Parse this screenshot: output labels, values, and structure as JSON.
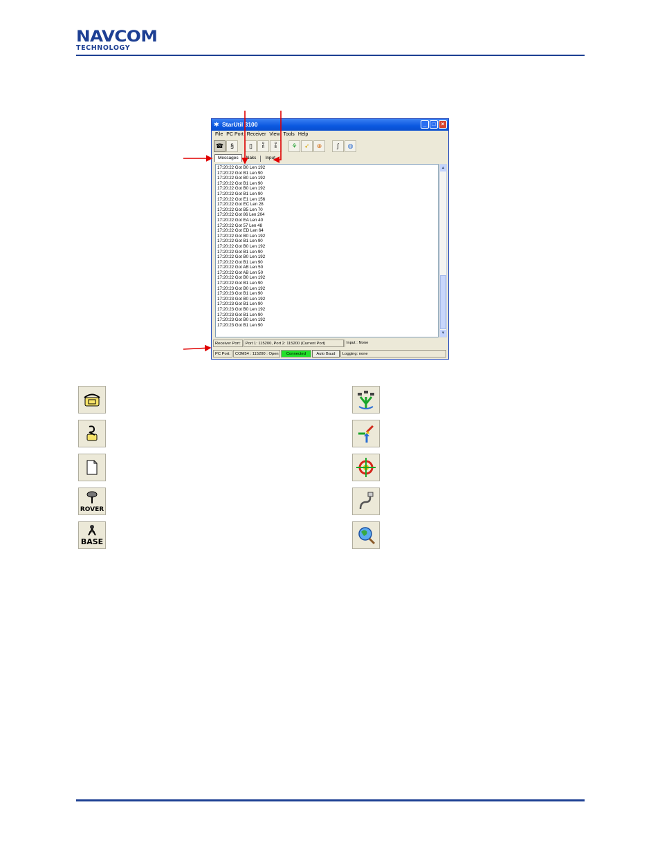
{
  "header": {
    "logo_main": "NAVCOM",
    "logo_sub": "TECHNOLOGY"
  },
  "window": {
    "title": "StarUtil 3100",
    "menu": [
      "File",
      "PC Port",
      "Receiver",
      "View",
      "Tools",
      "Help"
    ],
    "toolbar_icons": [
      "phone-connect-icon",
      "phone-disconnect-icon",
      "new-document-icon",
      "rover-icon",
      "base-icon",
      "network-icon",
      "merge-arrows-icon",
      "target-icon",
      "plug-icon",
      "globe-search-icon"
    ],
    "tabs": [
      "Messages",
      "Naks",
      "Input"
    ],
    "messages": [
      "17:20:22 Got B0 Len 192",
      "17:20:22 Got B1 Len 90",
      "17:20:22 Got B0 Len 192",
      "17:20:22 Got B1 Len 90",
      "17:20:22 Got B0 Len 192",
      "17:20:22 Got B1 Len 90",
      "17:20:22 Got E1 Len 156",
      "17:20:22 Got EC Len 28",
      "17:20:22 Got B5 Len 70",
      "17:20:22 Got 86 Len 204",
      "17:20:22 Got EA Len 40",
      "17:20:22 Got 57 Len 48",
      "17:20:22 Got ED Len 64",
      "17:20:22 Got B0 Len 192",
      "17:20:22 Got B1 Len 90",
      "17:20:22 Got B0 Len 192",
      "17:20:22 Got B1 Len 90",
      "17:20:22 Got B0 Len 192",
      "17:20:22 Got B1 Len 90",
      "17:20:22 Got AB Len 50",
      "17:20:22 Got AB Len 50",
      "17:20:22 Got B0 Len 192",
      "17:20:22 Got B1 Len 90",
      "17:20:23 Got B0 Len 192",
      "17:20:23 Got B1 Len 90",
      "17:20:23 Got B0 Len 192",
      "17:20:23 Got B1 Len 90",
      "17:20:23 Got B0 Len 192",
      "17:20:23 Got B1 Len 90",
      "17:20:23 Got B0 Len 192",
      "17:20:23 Got B1 Len 90"
    ],
    "status": {
      "receiver_port_label": "Receiver Port:",
      "receiver_port_value": "Port 1: 115200, Port 2: 115200 (Current Port)",
      "input": "Input : None",
      "pc_port_label": "PC Port:",
      "pc_port_value": "COM54 : 115200 : Open",
      "connection": "Connected",
      "auto_baud": "Auto Baud",
      "logging": "Logging: none"
    }
  },
  "legend_icons": {
    "left": [
      "phone-connect-icon",
      "phone-disconnect-icon",
      "new-document-icon",
      "rover-icon",
      "base-icon"
    ],
    "right": [
      "network-icon",
      "merge-arrows-icon",
      "target-icon",
      "plug-icon",
      "globe-search-icon"
    ],
    "rover_text": "ROVER",
    "base_text": "BASE"
  },
  "colors": {
    "brand": "#1d3f93",
    "arrow": "#e00000",
    "connected": "#22e12a"
  }
}
